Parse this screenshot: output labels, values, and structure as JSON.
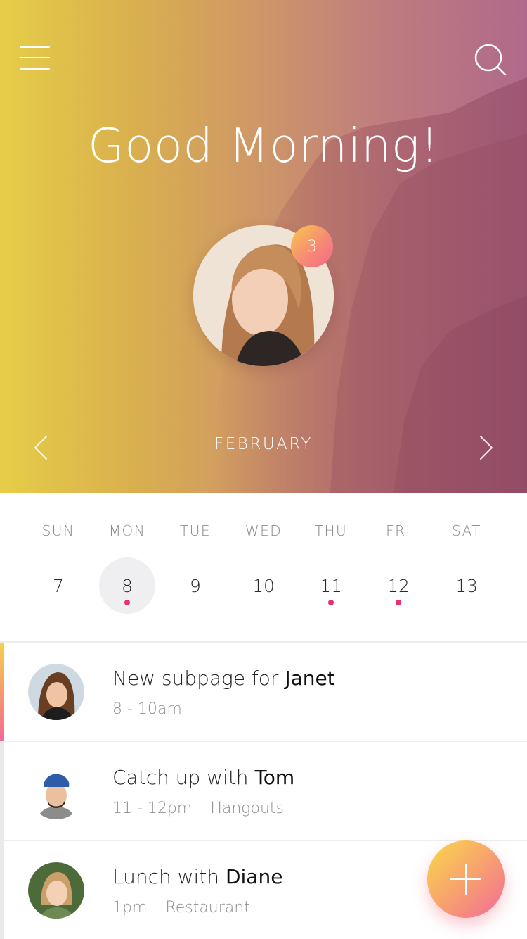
{
  "header": {
    "greeting": "Good Morning!",
    "notification_count": "3",
    "month": "FEBRUARY",
    "menu_icon": "hamburger-menu-icon",
    "search_icon": "search-icon"
  },
  "week": {
    "days": [
      {
        "name": "SUN",
        "date": "7",
        "selected": false,
        "has_event": false
      },
      {
        "name": "MON",
        "date": "8",
        "selected": true,
        "has_event": true
      },
      {
        "name": "TUE",
        "date": "9",
        "selected": false,
        "has_event": false
      },
      {
        "name": "WED",
        "date": "10",
        "selected": false,
        "has_event": false
      },
      {
        "name": "THU",
        "date": "11",
        "selected": false,
        "has_event": true
      },
      {
        "name": "FRI",
        "date": "12",
        "selected": false,
        "has_event": true
      },
      {
        "name": "SAT",
        "date": "13",
        "selected": false,
        "has_event": false
      }
    ]
  },
  "events": [
    {
      "title_prefix": "New subpage for ",
      "title_name": "Janet",
      "time": "8 - 10am",
      "location": "",
      "active": true
    },
    {
      "title_prefix": "Catch up with ",
      "title_name": "Tom",
      "time": "11 - 12pm",
      "location": "Hangouts",
      "active": false
    },
    {
      "title_prefix": "Lunch with ",
      "title_name": "Diane",
      "time": "1pm",
      "location": "Restaurant",
      "active": false
    }
  ],
  "colors": {
    "accent_pink": "#ea2f6e",
    "gradient_start": "#e6cd48",
    "gradient_end": "#b0698a"
  }
}
